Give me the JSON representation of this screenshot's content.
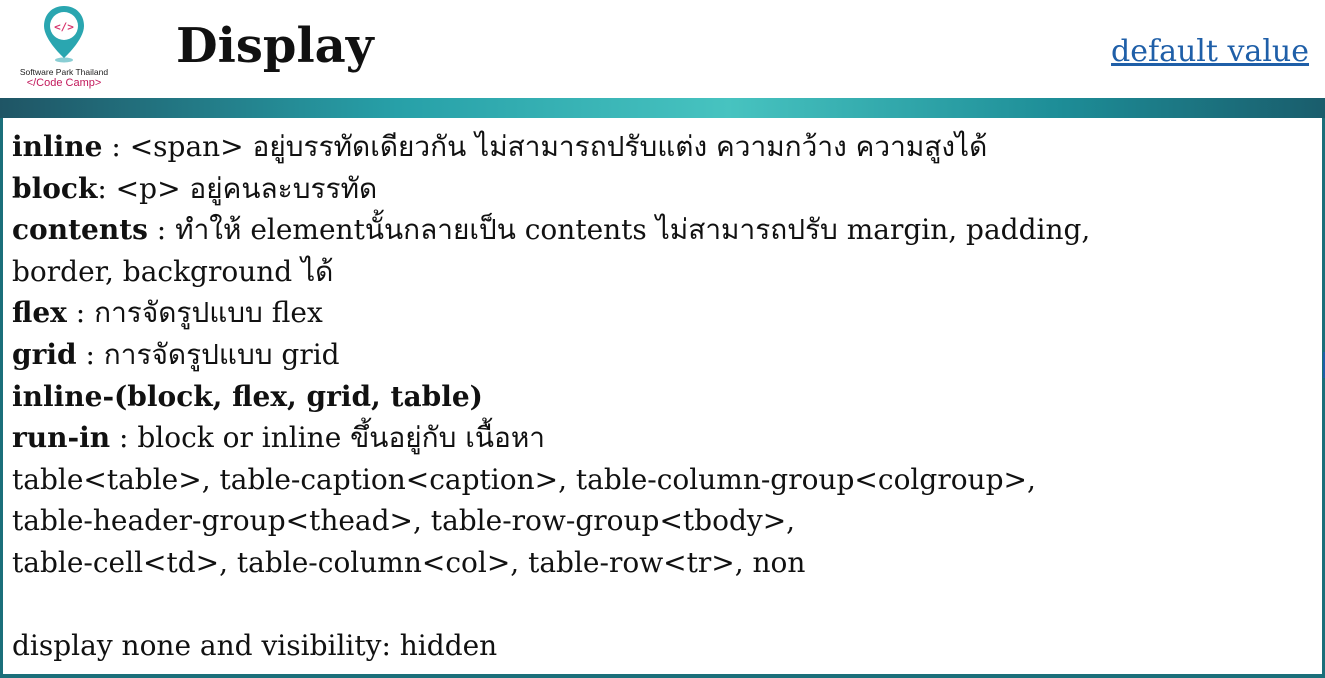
{
  "header": {
    "title": "Display",
    "link_text": "default value",
    "logo": {
      "icon": "location-pin-code-icon",
      "glyph": "</>",
      "brand": "Software Park Thailand",
      "subtitle": "</Code Camp>",
      "colors": {
        "pin": "#2aa6b0",
        "glyph": "#d6336c",
        "subtitle": "#c2185b"
      }
    }
  },
  "colors": {
    "band_start": "#1f5565",
    "band_mid": "#47c3c0",
    "link": "#1f5fa8"
  },
  "content": [
    {
      "term": "inline",
      "text": " : <span> อยู่บรรทัดเดียวกัน ไม่สามารถปรับแต่ง ความกว้าง ความสูงได้"
    },
    {
      "term": "block",
      "text": ": <p> อยู่คนละบรรทัด"
    },
    {
      "term": "contents",
      "text": " : ทำให้ elementนั้นกลายเป็น contents ไม่สามารถปรับ margin, padding,"
    },
    {
      "term": "",
      "text": "border, background ได้"
    },
    {
      "term": "flex",
      "text": " : การจัดรูปแบบ flex"
    },
    {
      "term": "grid",
      "text": " : การจัดรูปแบบ grid"
    },
    {
      "term": "inline-(block, flex, grid, table)",
      "text": ""
    },
    {
      "term": "run-in",
      "text": " : block or inline ขึ้นอยู่กับ เนื้อหา"
    },
    {
      "term": "",
      "text": "table<table>, table-caption<caption>, table-column-group<colgroup>,"
    },
    {
      "term": "",
      "text": "table-header-group<thead>, table-row-group<tbody>,"
    },
    {
      "term": "",
      "text": "table-cell<td>, table-column<col>, table-row<tr>, non"
    },
    {
      "term": "",
      "text": ""
    },
    {
      "term": "",
      "text": "display none and visibility: hidden"
    }
  ]
}
